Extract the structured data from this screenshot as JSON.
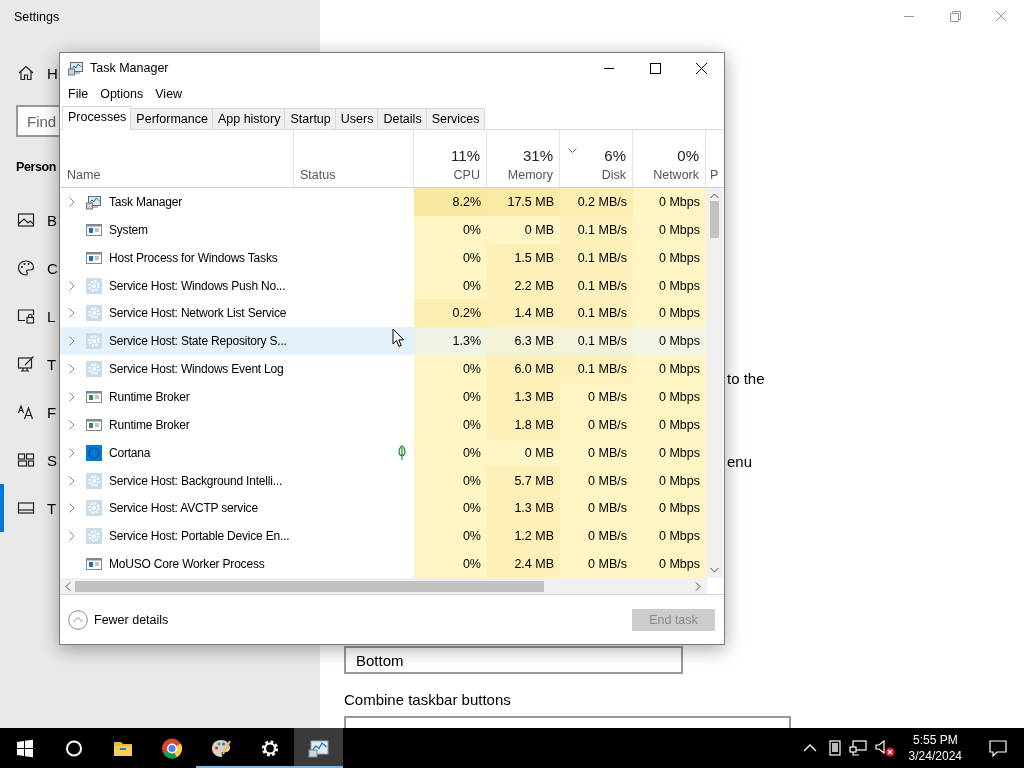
{
  "settings": {
    "title": "Settings",
    "home": {
      "label": "H",
      "kind": "home"
    },
    "search": {
      "placeholder": "Find"
    },
    "section": "Person",
    "items": [
      {
        "label": "B",
        "kind": "picture",
        "selected": false
      },
      {
        "label": "C",
        "kind": "palette",
        "selected": false
      },
      {
        "label": "L",
        "kind": "lock",
        "selected": false
      },
      {
        "label": "T",
        "kind": "brush",
        "selected": false
      },
      {
        "label": "F",
        "kind": "font",
        "selected": false
      },
      {
        "label": "S",
        "kind": "tiles",
        "selected": false
      },
      {
        "label": "T",
        "kind": "taskbar",
        "selected": true
      }
    ],
    "fragments": [
      "to the",
      "enu"
    ],
    "position_value": "Bottom",
    "combine_label": "Combine taskbar buttons"
  },
  "task_manager": {
    "title": "Task Manager",
    "menu": [
      "File",
      "Options",
      "View"
    ],
    "tabs": [
      {
        "label": "Processes",
        "selected": true
      },
      {
        "label": "Performance",
        "selected": false
      },
      {
        "label": "App history",
        "selected": false
      },
      {
        "label": "Startup",
        "selected": false
      },
      {
        "label": "Users",
        "selected": false
      },
      {
        "label": "Details",
        "selected": false
      },
      {
        "label": "Services",
        "selected": false
      }
    ],
    "name_header": "Name",
    "status_header": "Status",
    "columns": [
      {
        "label": "CPU",
        "percent": "11%",
        "sorted": false
      },
      {
        "label": "Memory",
        "percent": "31%",
        "sorted": false
      },
      {
        "label": "Disk",
        "percent": "6%",
        "sorted": true
      },
      {
        "label": "Network",
        "percent": "0%",
        "sorted": false
      },
      {
        "label": "P"
      }
    ],
    "rows": [
      {
        "name": "Task Manager",
        "kind": "taskmgr",
        "expandable": true,
        "eco": false,
        "hovered": false,
        "cells": [
          {
            "text": "8.2%",
            "color": "#f9e8a0"
          },
          {
            "text": "17.5 MB",
            "color": "#f9eaa6"
          },
          {
            "text": "0.2 MB/s",
            "color": "#fbeeb2"
          },
          {
            "text": "0 Mbps",
            "color": "#fff4c4"
          }
        ]
      },
      {
        "name": "System",
        "kind": "window",
        "expandable": false,
        "eco": false,
        "hovered": false,
        "cells": [
          {
            "text": "0%",
            "color": "#fff4c4"
          },
          {
            "text": "0 MB",
            "color": "#fff4c4"
          },
          {
            "text": "0.1 MB/s",
            "color": "#fff1bc"
          },
          {
            "text": "0 Mbps",
            "color": "#fff4c4"
          }
        ]
      },
      {
        "name": "Host Process for Windows Tasks",
        "kind": "window",
        "expandable": false,
        "eco": false,
        "hovered": false,
        "cells": [
          {
            "text": "0%",
            "color": "#fff4c4"
          },
          {
            "text": "1.5 MB",
            "color": "#fcefb7"
          },
          {
            "text": "0.1 MB/s",
            "color": "#fff1bc"
          },
          {
            "text": "0 Mbps",
            "color": "#fff4c4"
          }
        ]
      },
      {
        "name": "Service Host: Windows Push No...",
        "kind": "gear",
        "expandable": true,
        "eco": false,
        "hovered": false,
        "cells": [
          {
            "text": "0%",
            "color": "#fff4c4"
          },
          {
            "text": "2.2 MB",
            "color": "#fcefb7"
          },
          {
            "text": "0.1 MB/s",
            "color": "#fff1bc"
          },
          {
            "text": "0 Mbps",
            "color": "#fff4c4"
          }
        ]
      },
      {
        "name": "Service Host: Network List Service",
        "kind": "gear",
        "expandable": true,
        "eco": false,
        "hovered": false,
        "cells": [
          {
            "text": "0.2%",
            "color": "#fcefb2"
          },
          {
            "text": "1.4 MB",
            "color": "#fcefb7"
          },
          {
            "text": "0.1 MB/s",
            "color": "#fff1bc"
          },
          {
            "text": "0 Mbps",
            "color": "#fff4c4"
          }
        ]
      },
      {
        "name": "Service Host: State Repository S...",
        "kind": "gear",
        "expandable": true,
        "eco": false,
        "hovered": true,
        "cells": [
          {
            "text": "1.3%",
            "color": "#eef3e4"
          },
          {
            "text": "6.3 MB",
            "color": "#f3f3d8"
          },
          {
            "text": "0.1 MB/s",
            "color": "#f3f3dc"
          },
          {
            "text": "0 Mbps",
            "color": "#f3f5e4"
          }
        ]
      },
      {
        "name": "Service Host: Windows Event Log",
        "kind": "gear",
        "expandable": true,
        "eco": false,
        "hovered": false,
        "cells": [
          {
            "text": "0%",
            "color": "#fff4c4"
          },
          {
            "text": "6.0 MB",
            "color": "#fcefb7"
          },
          {
            "text": "0.1 MB/s",
            "color": "#fff1bc"
          },
          {
            "text": "0 Mbps",
            "color": "#fff4c4"
          }
        ]
      },
      {
        "name": "Runtime Broker",
        "kind": "window-green",
        "expandable": true,
        "eco": false,
        "hovered": false,
        "cells": [
          {
            "text": "0%",
            "color": "#fff4c4"
          },
          {
            "text": "1.3 MB",
            "color": "#fcefb7"
          },
          {
            "text": "0 MB/s",
            "color": "#fff4c4"
          },
          {
            "text": "0 Mbps",
            "color": "#fff4c4"
          }
        ]
      },
      {
        "name": "Runtime Broker",
        "kind": "window-green",
        "expandable": true,
        "eco": false,
        "hovered": false,
        "cells": [
          {
            "text": "0%",
            "color": "#fff4c4"
          },
          {
            "text": "1.8 MB",
            "color": "#fcefb7"
          },
          {
            "text": "0 MB/s",
            "color": "#fff4c4"
          },
          {
            "text": "0 Mbps",
            "color": "#fff4c4"
          }
        ]
      },
      {
        "name": "Cortana",
        "kind": "cortana",
        "expandable": true,
        "eco": true,
        "hovered": false,
        "cells": [
          {
            "text": "0%",
            "color": "#fff4c4"
          },
          {
            "text": "0 MB",
            "color": "#fff4c4"
          },
          {
            "text": "0 MB/s",
            "color": "#fff4c4"
          },
          {
            "text": "0 Mbps",
            "color": "#fff4c4"
          }
        ]
      },
      {
        "name": "Service Host: Background Intelli...",
        "kind": "gear",
        "expandable": true,
        "eco": false,
        "hovered": false,
        "cells": [
          {
            "text": "0%",
            "color": "#fff4c4"
          },
          {
            "text": "5.7 MB",
            "color": "#fcefb7"
          },
          {
            "text": "0 MB/s",
            "color": "#fff4c4"
          },
          {
            "text": "0 Mbps",
            "color": "#fff4c4"
          }
        ]
      },
      {
        "name": "Service Host: AVCTP service",
        "kind": "gear",
        "expandable": true,
        "eco": false,
        "hovered": false,
        "cells": [
          {
            "text": "0%",
            "color": "#fff4c4"
          },
          {
            "text": "1.3 MB",
            "color": "#fcefb7"
          },
          {
            "text": "0 MB/s",
            "color": "#fff4c4"
          },
          {
            "text": "0 Mbps",
            "color": "#fff4c4"
          }
        ]
      },
      {
        "name": "Service Host: Portable Device En...",
        "kind": "gear",
        "expandable": true,
        "eco": false,
        "hovered": false,
        "cells": [
          {
            "text": "0%",
            "color": "#fff4c4"
          },
          {
            "text": "1.2 MB",
            "color": "#fcefb7"
          },
          {
            "text": "0 MB/s",
            "color": "#fff4c4"
          },
          {
            "text": "0 Mbps",
            "color": "#fff4c4"
          }
        ]
      },
      {
        "name": "MoUSO Core Worker Process",
        "kind": "window",
        "expandable": false,
        "eco": false,
        "hovered": false,
        "cells": [
          {
            "text": "0%",
            "color": "#fff4c4"
          },
          {
            "text": "2.4 MB",
            "color": "#fcefb7"
          },
          {
            "text": "0 MB/s",
            "color": "#fff4c4"
          },
          {
            "text": "0 Mbps",
            "color": "#fff4c4"
          }
        ]
      }
    ],
    "fewer_details": "Fewer details",
    "end_task": {
      "label": "End task",
      "disabled": true
    }
  },
  "taskbar": {
    "apps": [
      {
        "kind": "start",
        "running": false,
        "active": false
      },
      {
        "kind": "search",
        "running": false,
        "active": false
      },
      {
        "kind": "folder",
        "running": false,
        "active": false
      },
      {
        "kind": "chrome",
        "running": false,
        "active": false
      },
      {
        "kind": "paint",
        "running": true,
        "active": false
      },
      {
        "kind": "gear",
        "running": true,
        "active": false
      },
      {
        "kind": "taskmgr",
        "running": true,
        "active": true
      }
    ],
    "time": "5:55 PM",
    "date": "3/24/2024"
  }
}
